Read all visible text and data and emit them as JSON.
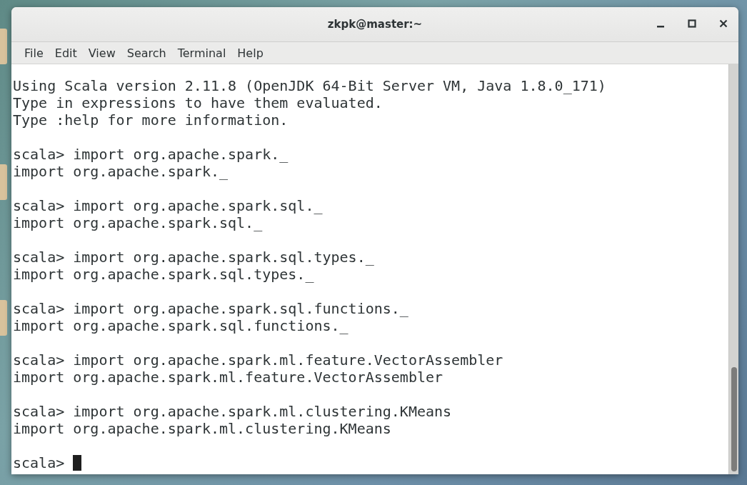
{
  "window": {
    "title": "zkpk@master:~"
  },
  "menu": [
    "File",
    "Edit",
    "View",
    "Search",
    "Terminal",
    "Help"
  ],
  "terminal": {
    "blocks": [
      {
        "lines": [
          "Using Scala version 2.11.8 (OpenJDK 64-Bit Server VM, Java 1.8.0_171)",
          "Type in expressions to have them evaluated.",
          "Type :help for more information."
        ]
      },
      {
        "lines": [
          "scala> import org.apache.spark._",
          "import org.apache.spark._"
        ]
      },
      {
        "lines": [
          "scala> import org.apache.spark.sql._",
          "import org.apache.spark.sql._"
        ]
      },
      {
        "lines": [
          "scala> import org.apache.spark.sql.types._",
          "import org.apache.spark.sql.types._"
        ]
      },
      {
        "lines": [
          "scala> import org.apache.spark.sql.functions._",
          "import org.apache.spark.sql.functions._"
        ]
      },
      {
        "lines": [
          "scala> import org.apache.spark.ml.feature.VectorAssembler",
          "import org.apache.spark.ml.feature.VectorAssembler"
        ]
      },
      {
        "lines": [
          "scala> import org.apache.spark.ml.clustering.KMeans",
          "import org.apache.spark.ml.clustering.KMeans"
        ]
      }
    ],
    "prompt": "scala>",
    "cursor": true
  }
}
